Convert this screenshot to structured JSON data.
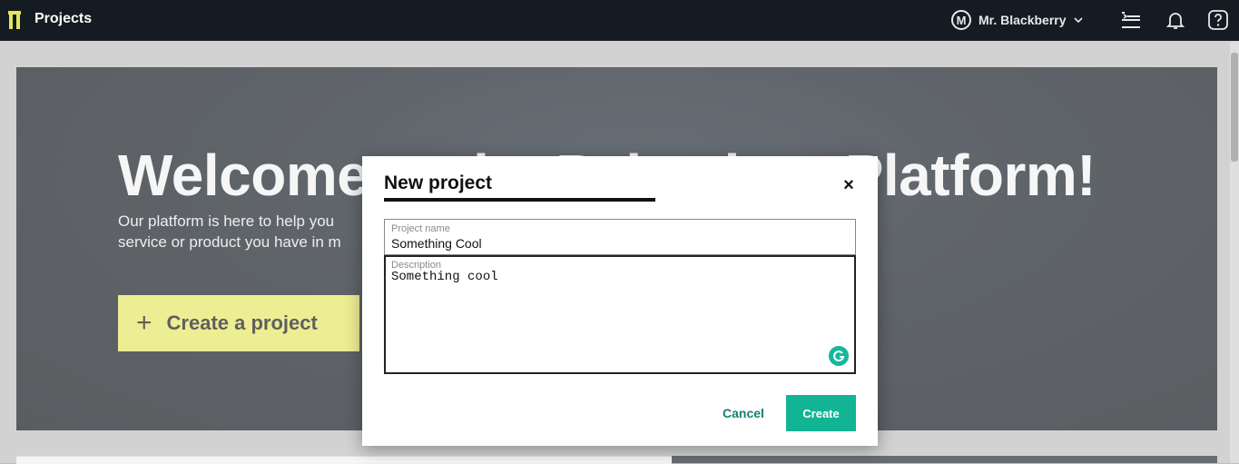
{
  "topbar": {
    "title": "Projects",
    "user": {
      "initial": "M",
      "name": "Mr. Blackberry"
    },
    "icons": [
      "logo-icon",
      "chevron-down-icon",
      "timeline-icon",
      "bell-icon",
      "help-icon"
    ]
  },
  "hero": {
    "title": "Welcome to the Paltechno Platform!",
    "subtitle_line1": "Our platform is here to help you",
    "subtitle_line2": "service or product you have in m",
    "create_button_label": "Create a project"
  },
  "modal": {
    "title": "New project",
    "project_name": {
      "label": "Project name",
      "value": "Something Cool"
    },
    "description": {
      "label": "Description",
      "value": "Something cool"
    },
    "cancel_label": "Cancel",
    "create_label": "Create"
  },
  "colors": {
    "topbar": "#141b22",
    "accent": "#13b495",
    "create_project_button": "#e4e45f"
  }
}
